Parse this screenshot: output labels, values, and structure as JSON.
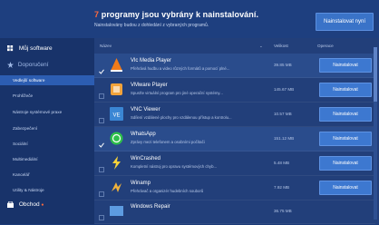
{
  "header": {
    "count": "7",
    "title_rest": "programy jsou vybrány k nainstalování.",
    "subtitle": "Nainstalovány budou z dohledání z vybraných programů.",
    "install_now": "Nainstalovat nyní"
  },
  "sidebar": {
    "my_software": "Můj software",
    "section": "Doporučení",
    "items": [
      {
        "label": "Vedlejší software",
        "active": true
      },
      {
        "label": "Prohlížeče",
        "active": false
      },
      {
        "label": "Nástroje systémové praxe",
        "active": false
      },
      {
        "label": "Zabezpečení",
        "active": false
      },
      {
        "label": "Sociální",
        "active": false
      },
      {
        "label": "Multimediální",
        "active": false
      },
      {
        "label": "Kancelář",
        "active": false
      },
      {
        "label": "Utility & Nástroje",
        "active": false
      }
    ],
    "bottom": "Obchod"
  },
  "columns": {
    "name": "Název",
    "size": "Velikost",
    "action": "Operace"
  },
  "apps": [
    {
      "name": "Vlc Media Player",
      "desc": "Přehrává hudbu a video různých formátů a pomocí plné...",
      "size": "39.85 MB",
      "button": "Nainstalovat",
      "checked": true,
      "icon": "vlc-icon",
      "color": "#f07b1a"
    },
    {
      "name": "VMware Player",
      "desc": "Spusťte virtuální program pro jiné operační systémy...",
      "size": "145.67 MB",
      "button": "Nainstalovat",
      "checked": false,
      "icon": "vmware-icon",
      "color": "#f2a33b"
    },
    {
      "name": "VNC Viewer",
      "desc": "Sdílení vzdálené plochy pro vzdálenou přístup a kontrolu...",
      "size": "10.57 MB",
      "button": "Nainstalovat",
      "checked": false,
      "icon": "vnc-icon",
      "color": "#3a86d4"
    },
    {
      "name": "WhatsApp",
      "desc": "Zprávy mezi telefonem a osobními počítači",
      "size": "151.12 MB",
      "button": "Nainstalovat",
      "checked": true,
      "icon": "whatsapp-icon",
      "color": "#2fbf4b"
    },
    {
      "name": "WinCrashed",
      "desc": "Kompletní nástroj pro opravu systémových chyb...",
      "size": "5.48 MB",
      "button": "Nainstalovat",
      "checked": false,
      "icon": "wincrashed-icon",
      "color": "#f6d23a"
    },
    {
      "name": "Winamp",
      "desc": "Přehrávač a organizér hudebních souborů",
      "size": "7.92 MB",
      "button": "Nainstalovat",
      "checked": false,
      "icon": "winamp-icon",
      "color": "#f1b23b"
    },
    {
      "name": "Windows Repair",
      "desc": "",
      "size": "36.75 MB",
      "button": "",
      "checked": false,
      "icon": "windows-repair-icon",
      "color": "#5d9be0"
    }
  ]
}
